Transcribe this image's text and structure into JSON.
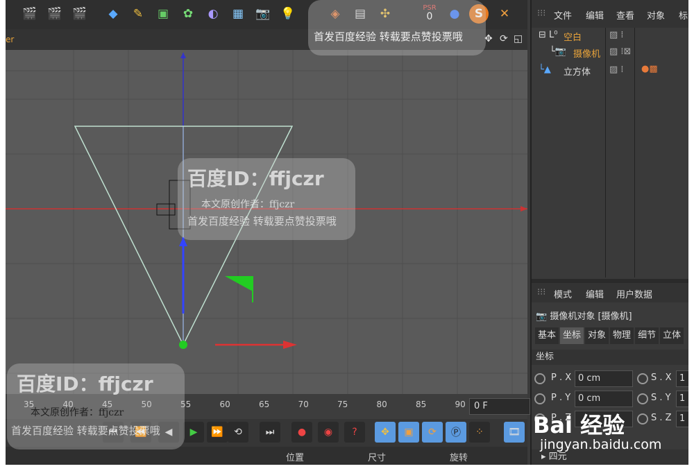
{
  "viewport": {
    "header_label": "er"
  },
  "timeline": {
    "ticks": [
      "35",
      "40",
      "45",
      "50",
      "55",
      "60",
      "65",
      "70",
      "75",
      "80",
      "85",
      "90"
    ],
    "frame_field": "0 F"
  },
  "bottom_bar": {
    "position_label": "位置",
    "size_label": "尺寸",
    "rotation_label": "旋转"
  },
  "object_manager": {
    "menu": [
      "文件",
      "编辑",
      "查看",
      "对象",
      "标"
    ],
    "objects": [
      {
        "name": "空白",
        "color": "#e8a33a"
      },
      {
        "name": "摄像机",
        "color": "#e8a33a"
      },
      {
        "name": "立方体",
        "color": "#dddddd"
      }
    ]
  },
  "attribute_manager": {
    "menu": [
      "模式",
      "编辑",
      "用户数据"
    ],
    "title": "摄像机对象 [摄像机]",
    "tabs": [
      "基本",
      "坐标",
      "对象",
      "物理",
      "细节",
      "立体"
    ],
    "active_tab": "坐标",
    "section": "坐标",
    "fields": [
      {
        "label": "P . X",
        "value": "0 cm",
        "s_label": "S . X",
        "s_value": "1"
      },
      {
        "label": "P . Y",
        "value": "0 cm",
        "s_label": "S . Y",
        "s_value": "1"
      },
      {
        "label": "P . Z",
        "value": "",
        "s_label": "S . Z",
        "s_value": "1"
      }
    ],
    "footer": "四元"
  },
  "toolbar": {
    "psr_label": "PSR",
    "psr_value": "0"
  },
  "watermarks": {
    "brand": "百度ID：ffjczr",
    "author": "本文原创作者：ffjczr",
    "notice": "首发百度经验  转载要点赞投票哦",
    "corner_brand": "Bai 经验",
    "corner_url": "jingyan.baidu.com"
  },
  "colors": {
    "accent": "#e8a33a",
    "viewport": "#5a5a5a",
    "panel": "#3a3a3a",
    "active_tab": "#575757"
  }
}
